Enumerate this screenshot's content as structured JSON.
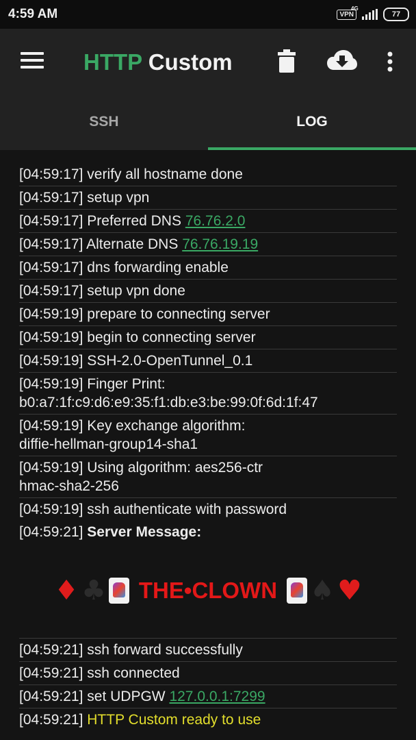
{
  "status": {
    "time": "4:59 AM",
    "vpn": "VPN",
    "network": "4G",
    "battery": "77"
  },
  "app": {
    "title_part1": "HTTP",
    "title_part2": "Custom"
  },
  "icons": {
    "menu": "menu-icon",
    "delete": "trash-icon",
    "download": "cloud-download-icon",
    "more": "more-vert-icon"
  },
  "tabs": [
    {
      "label": "SSH",
      "active": false
    },
    {
      "label": "LOG",
      "active": true
    }
  ],
  "colors": {
    "accent": "#3aa864",
    "highlight": "#e3de2c",
    "banner": "#e31818"
  },
  "log": [
    {
      "time": "[04:59:17]",
      "text": "verify all hostname done"
    },
    {
      "time": "[04:59:17]",
      "text": "setup vpn"
    },
    {
      "time": "[04:59:17]",
      "text": "Preferred DNS",
      "link": "76.76.2.0"
    },
    {
      "time": "[04:59:17]",
      "text": "Alternate DNS",
      "link": "76.76.19.19"
    },
    {
      "time": "[04:59:17]",
      "text": "dns forwarding enable"
    },
    {
      "time": "[04:59:17]",
      "text": "setup vpn done"
    },
    {
      "time": "[04:59:19]",
      "text": "prepare to connecting server"
    },
    {
      "time": "[04:59:19]",
      "text": "begin to connecting server"
    },
    {
      "time": "[04:59:19]",
      "text": "SSH-2.0-OpenTunnel_0.1"
    },
    {
      "time": "[04:59:19]",
      "text": "Finger Print:",
      "text2": "b0:a7:1f:c9:d6:e9:35:f1:db:e3:be:99:0f:6d:1f:47"
    },
    {
      "time": "[04:59:19]",
      "text": "Key exchange algorithm:",
      "text2": "diffie-hellman-group14-sha1"
    },
    {
      "time": "[04:59:19]",
      "text": "Using algorithm: aes256-ctr",
      "text2": "hmac-sha2-256"
    },
    {
      "time": "[04:59:19]",
      "text": "ssh authenticate with password"
    },
    {
      "time": "[04:59:21]",
      "text": "Server Message:"
    },
    {
      "time": "[04:59:21]",
      "text": "ssh forward successfully"
    },
    {
      "time": "[04:59:21]",
      "text": "ssh connected"
    },
    {
      "time": "[04:59:21]",
      "text": "set UDPGW",
      "link": "127.0.0.1:7299"
    },
    {
      "time": "[04:59:21]",
      "text": "HTTP Custom ready to use"
    }
  ],
  "banner": {
    "text": "THE•CLOWN",
    "suits_left": [
      "♦",
      "♣"
    ],
    "suits_right": [
      "♠",
      "♥"
    ]
  }
}
